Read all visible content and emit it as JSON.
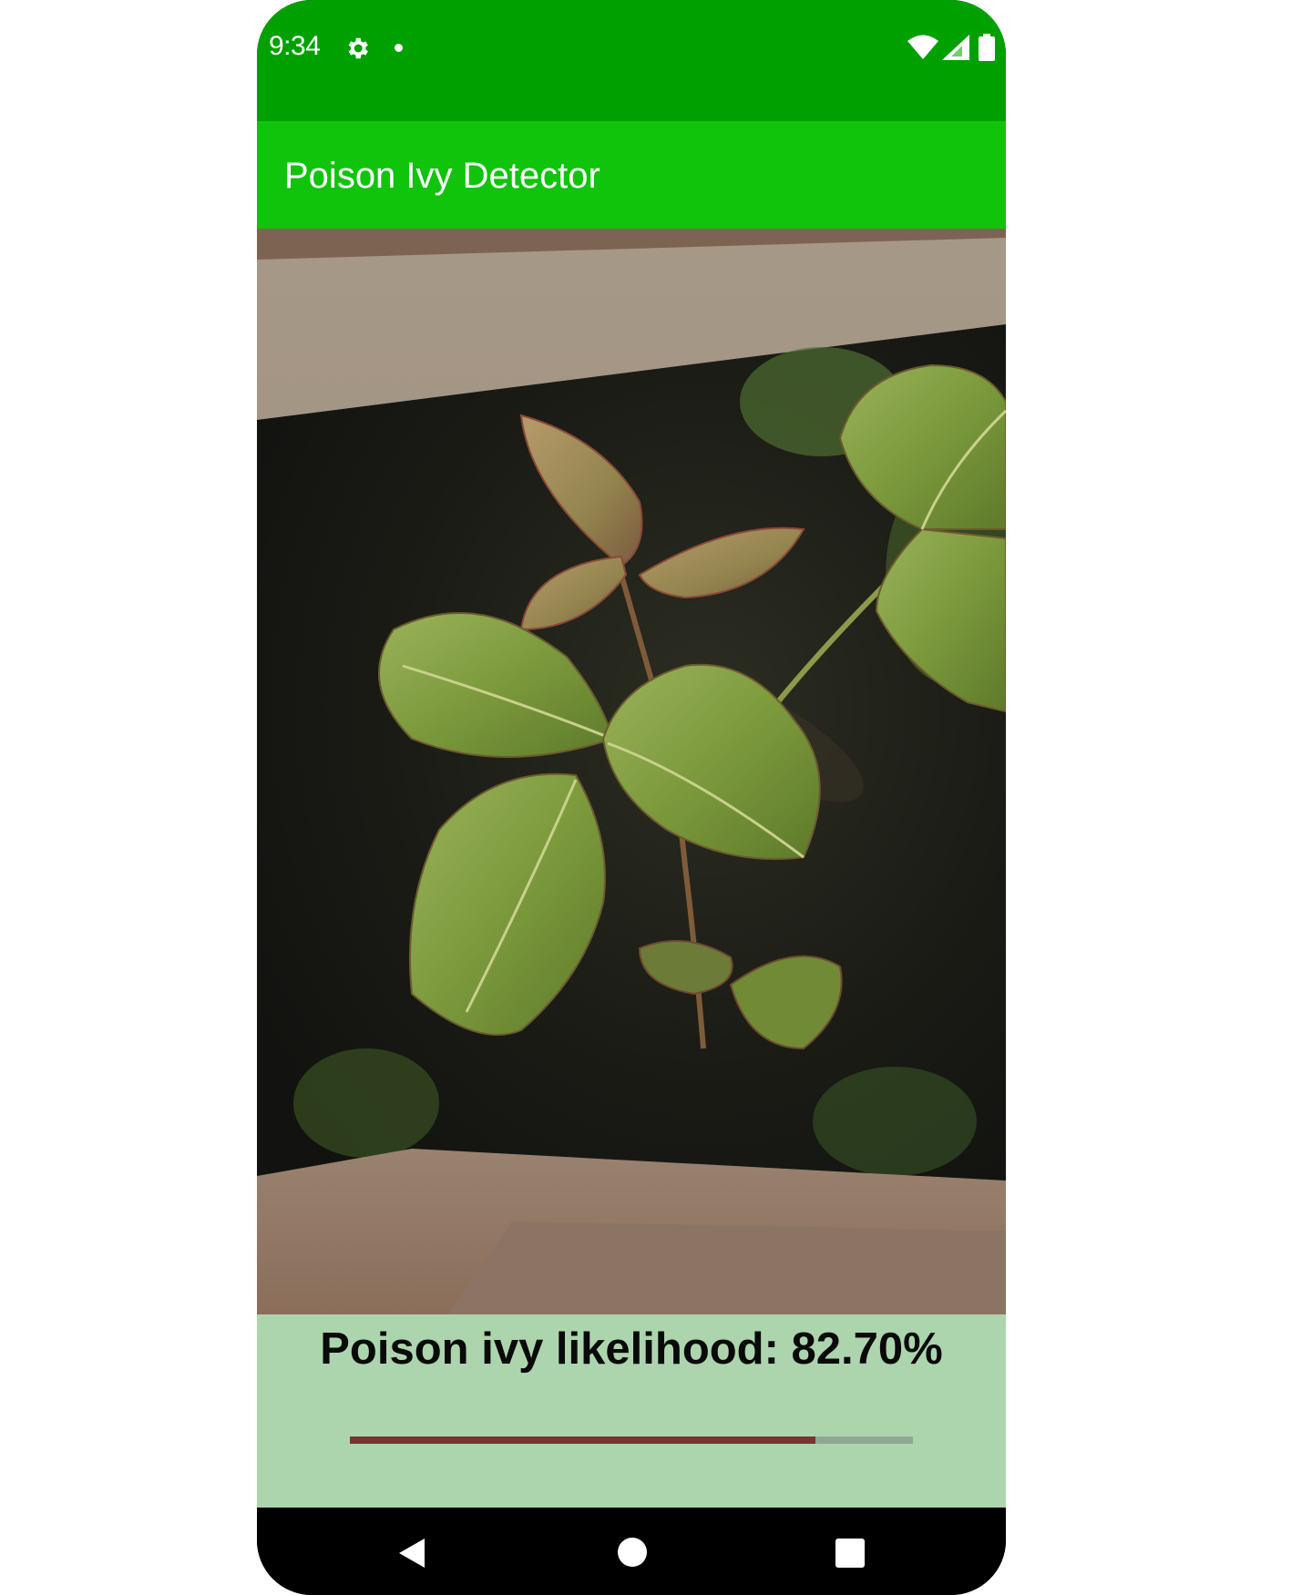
{
  "status_bar": {
    "time": "9:34",
    "icons": [
      "gear-icon",
      "notification-dot-icon",
      "wifi-icon",
      "cell-signal-icon",
      "battery-icon"
    ],
    "background": "#01a001"
  },
  "app_bar": {
    "title": "Poison Ivy Detector",
    "background": "#10c40c"
  },
  "photo": {
    "subject": "poison-ivy-plant-photo"
  },
  "result": {
    "text": "Poison ivy likelihood: 82.70%",
    "likelihood_fraction": 0.827,
    "panel_color": "#acd5ae",
    "bar_color": "#7a3330"
  },
  "nav_bar": {
    "buttons": [
      "back-icon",
      "home-icon",
      "recents-icon"
    ]
  }
}
